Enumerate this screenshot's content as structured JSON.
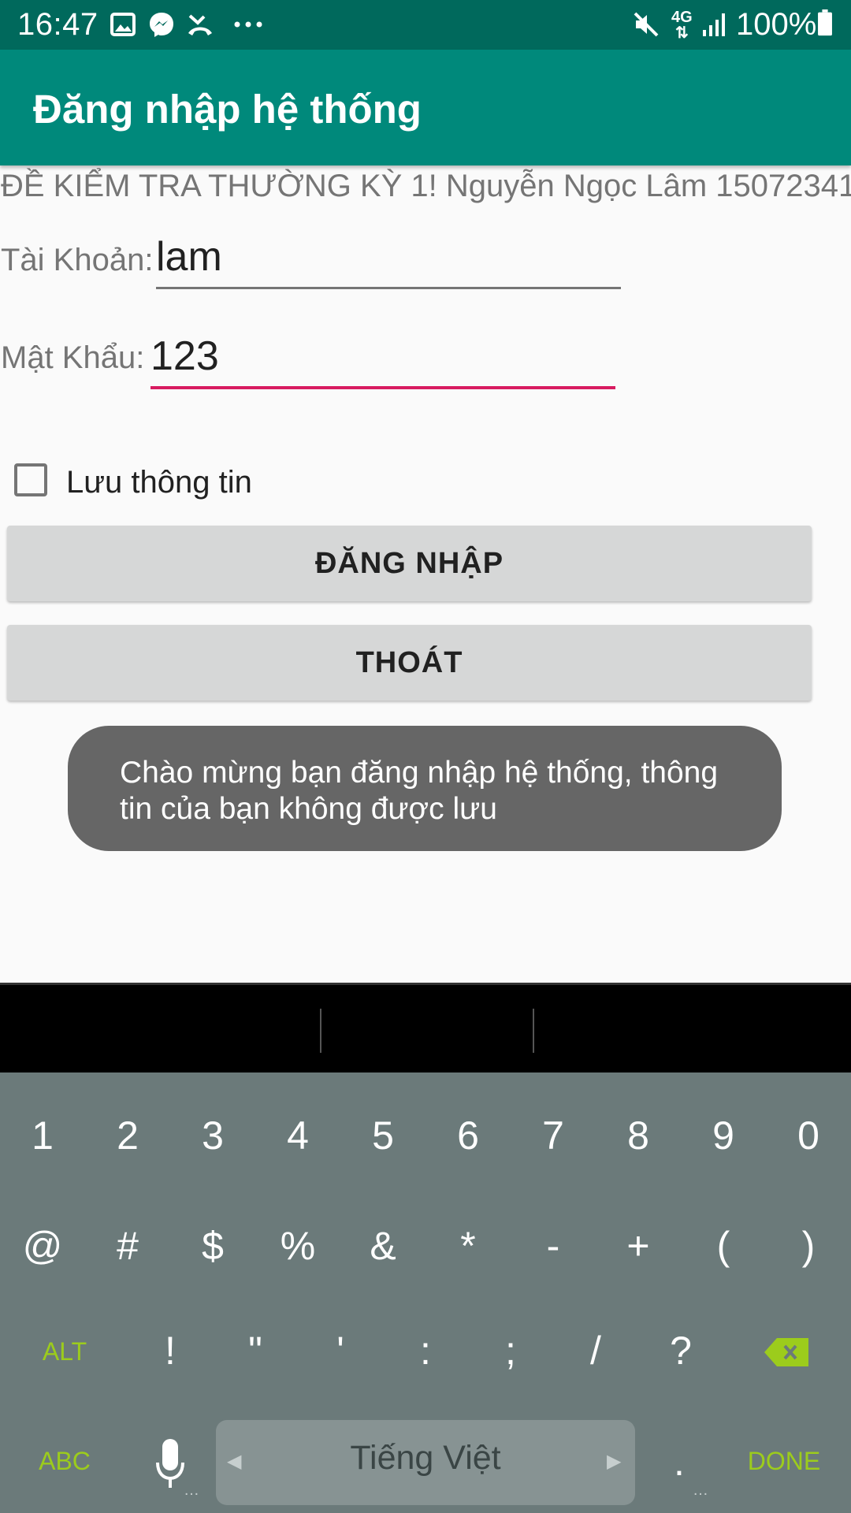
{
  "status_bar": {
    "time": "16:47",
    "battery": "100%",
    "network": "4G",
    "icons": [
      "image-icon",
      "messenger-icon",
      "missed-call-icon",
      "more-dots-icon",
      "mute-icon",
      "network-4g-icon",
      "signal-icon",
      "battery-icon"
    ]
  },
  "app_bar": {
    "title": "Đăng nhập hệ thống",
    "color": "#00897b"
  },
  "form": {
    "heading": "ĐỀ KIỂM TRA THƯỜNG KỲ 1! Nguyễn Ngọc Lâm 15072341",
    "account_label": "Tài Khoản:",
    "account_value": "lam",
    "password_label": "Mật Khẩu:",
    "password_value": "123",
    "remember_label": "Lưu thông tin",
    "remember_checked": false,
    "login_button": "ĐĂNG NHẬP",
    "exit_button": "THOÁT",
    "accent_color": "#d81b60"
  },
  "toast": {
    "text": "Chào mừng bạn đăng nhập hệ thống, thông tin của bạn không được lưu"
  },
  "keyboard": {
    "row1": [
      "1",
      "2",
      "3",
      "4",
      "5",
      "6",
      "7",
      "8",
      "9",
      "0"
    ],
    "row2": [
      "@",
      "#",
      "$",
      "%",
      "&",
      "*",
      "-",
      "+",
      "(",
      ")"
    ],
    "row3": [
      "!",
      "\"",
      "'",
      ":",
      ";",
      "/",
      "?"
    ],
    "alt": "ALT",
    "abc": "ABC",
    "done": "DONE",
    "language": "Tiếng Việt",
    "period": ".",
    "accent": "#9ccc1c"
  }
}
